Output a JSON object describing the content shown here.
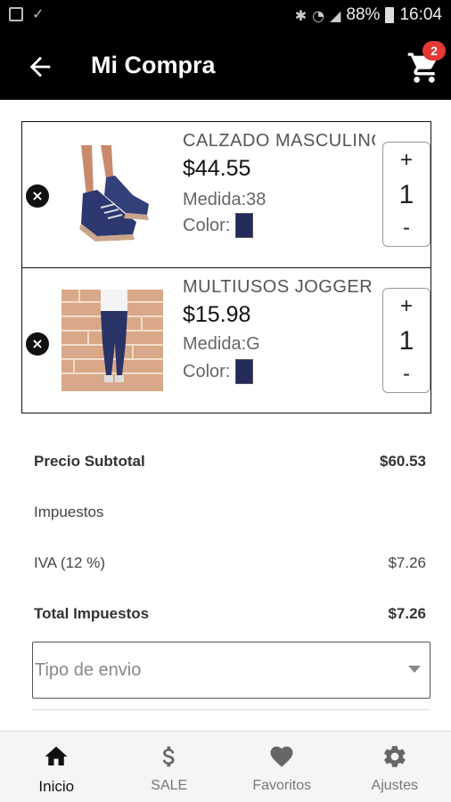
{
  "status_bar": {
    "battery": "88%",
    "time": "16:04"
  },
  "header": {
    "title": "Mi Compra",
    "cart_badge": "2",
    "back_icon": "arrow-left-icon",
    "cart_icon": "shopping-cart-icon"
  },
  "cart": {
    "items": [
      {
        "name": "CALZADO MASCULINO",
        "price": "$44.55",
        "size": "Medida:38",
        "color_label": "Color:",
        "color_hex": "#242a5c",
        "plus": "+",
        "quantity": "1",
        "minus": "-"
      },
      {
        "name": "MULTIUSOS JOGGER",
        "price": "$15.98",
        "size": "Medida:G",
        "color_label": "Color:",
        "color_hex": "#242a5c",
        "plus": "+",
        "quantity": "1",
        "minus": "-"
      }
    ]
  },
  "summary": {
    "subtotal_label": "Precio Subtotal",
    "subtotal_value": "$60.53",
    "taxes_label": "Impuestos",
    "iva_label": "IVA (12 %)",
    "iva_value": "$7.26",
    "total_taxes_label": "Total Impuestos",
    "total_taxes_value": "$7.26"
  },
  "shipping": {
    "placeholder": "Tipo de envio"
  },
  "bottom_nav": {
    "items": [
      {
        "label": "Inicio",
        "icon": "home-icon",
        "active": true
      },
      {
        "label": "SALE",
        "icon": "dollar-icon",
        "active": false
      },
      {
        "label": "Favoritos",
        "icon": "heart-icon",
        "active": false
      },
      {
        "label": "Ajustes",
        "icon": "gear-icon",
        "active": false
      }
    ]
  },
  "colors": {
    "app_bar": "#000000",
    "badge": "#e53935",
    "swatch": "#242a5c"
  }
}
